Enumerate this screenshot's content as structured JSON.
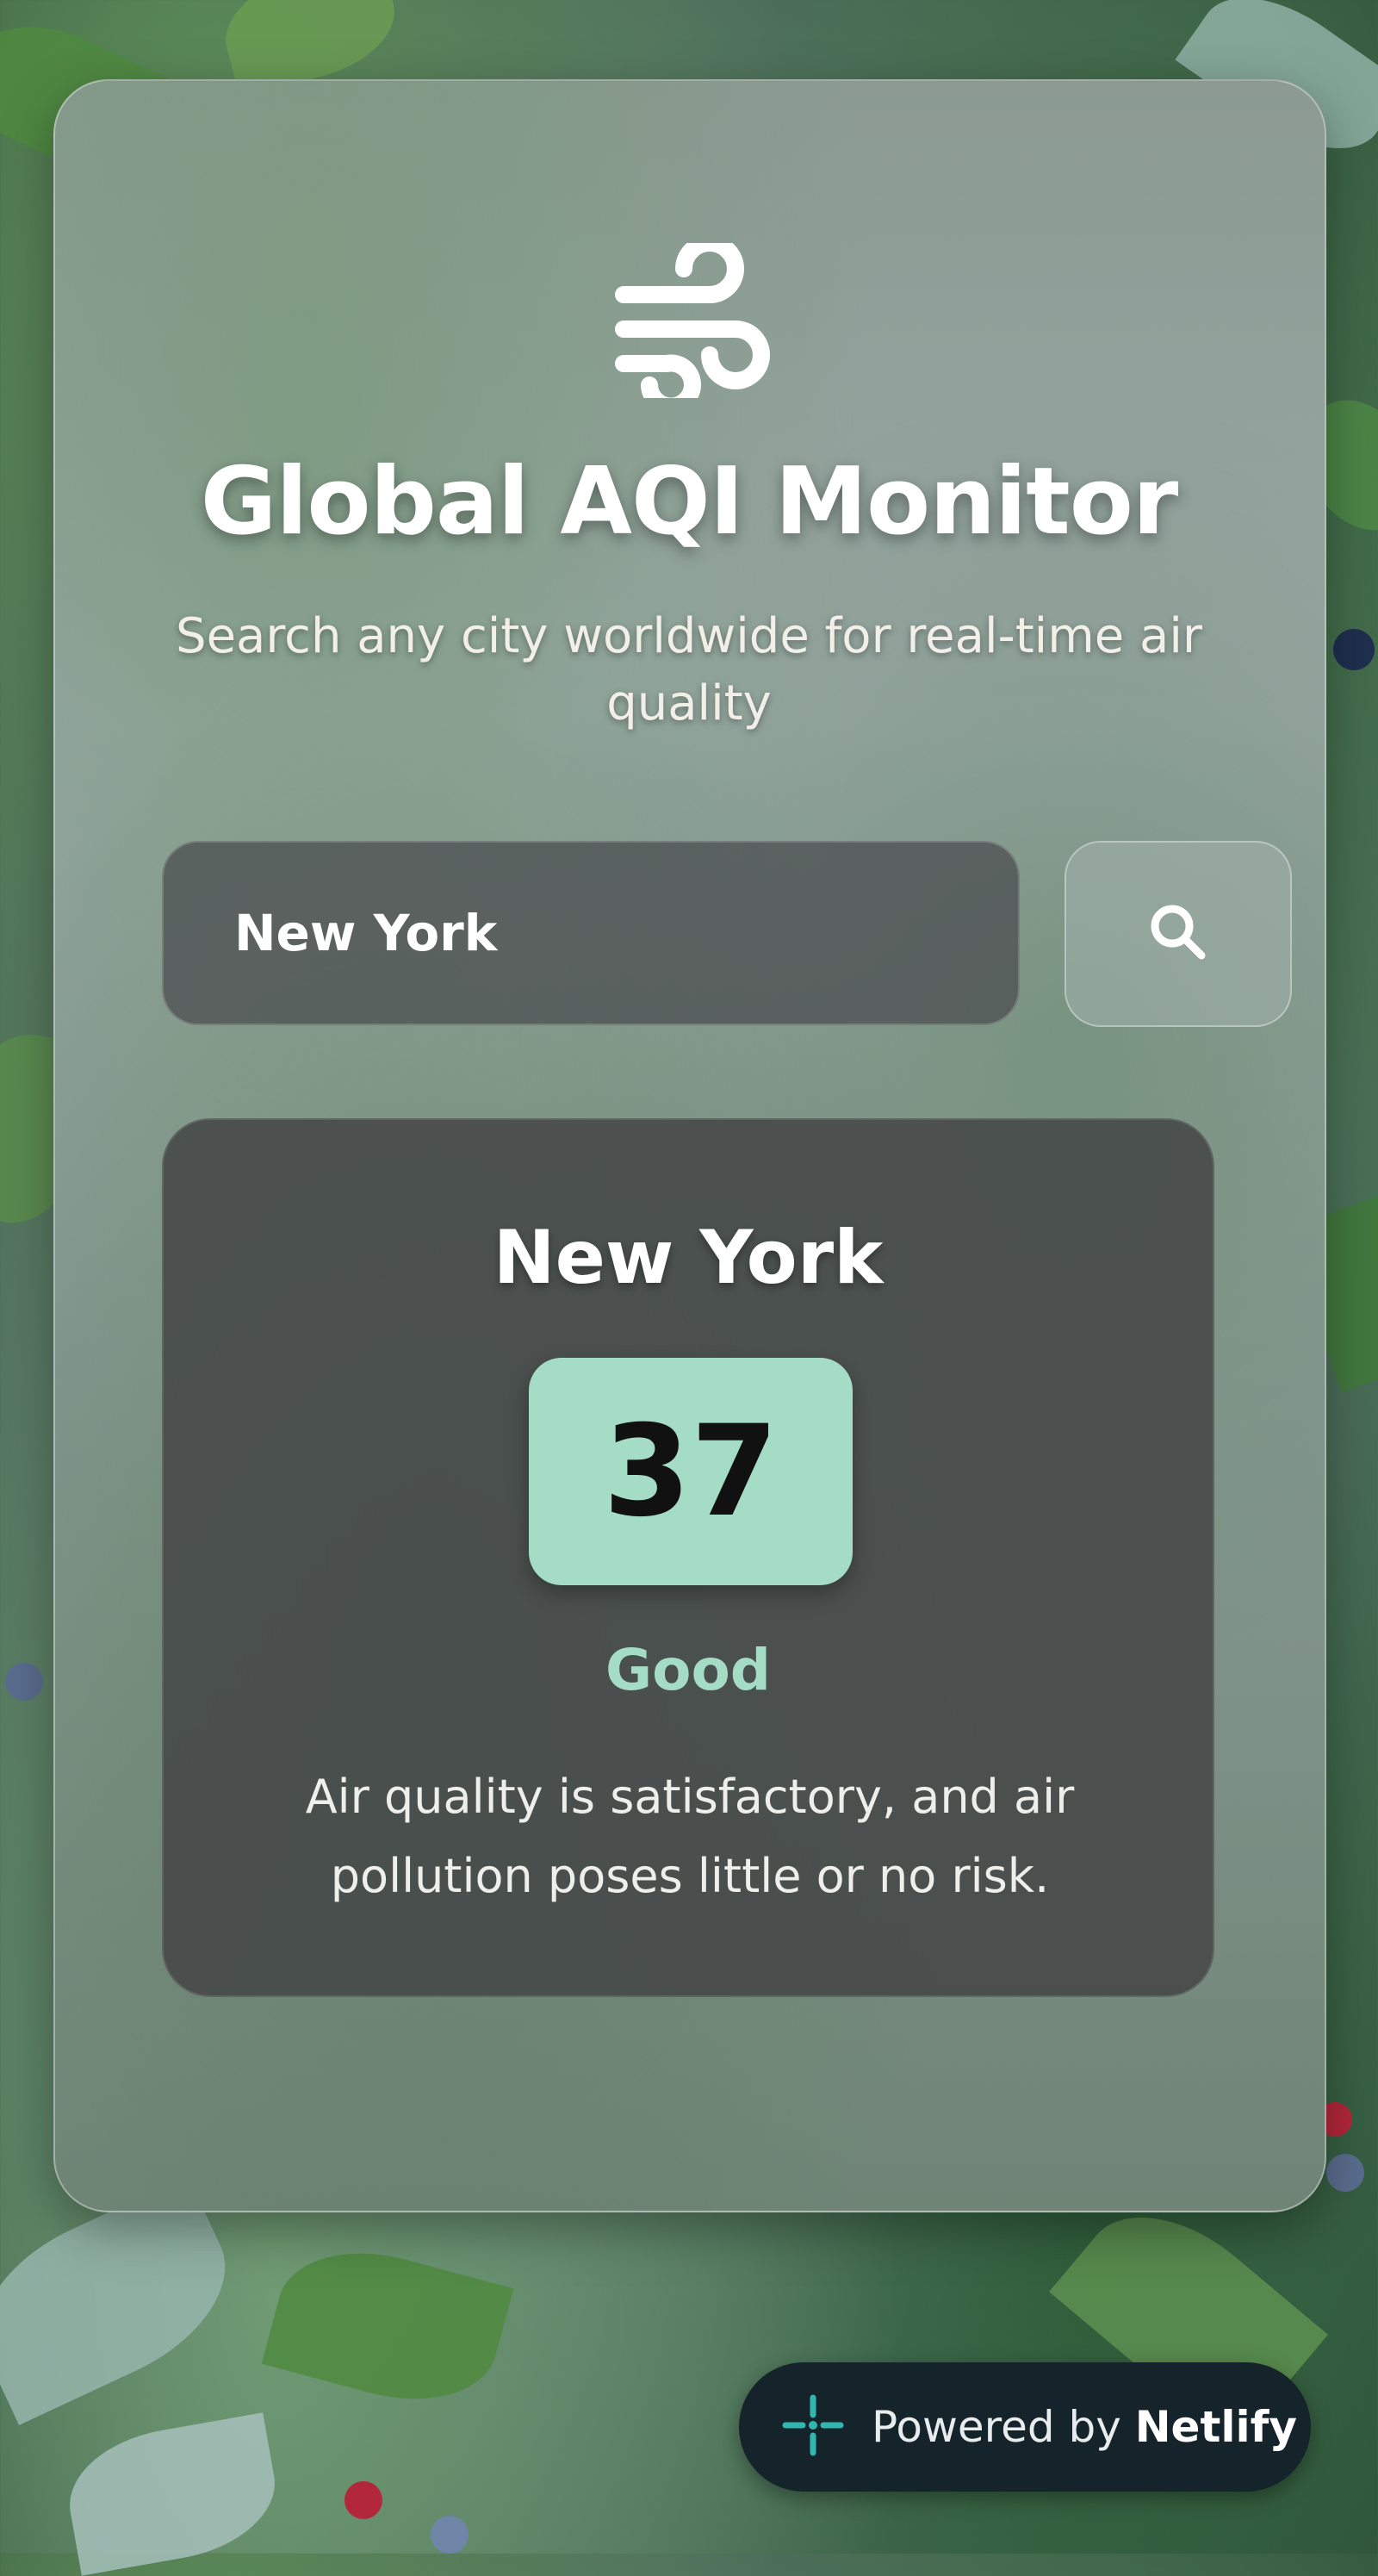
{
  "app": {
    "title": "Global AQI Monitor",
    "subtitle": "Search any city worldwide for real-time air quality",
    "logo_icon": "wind-icon"
  },
  "search": {
    "value": "New York",
    "placeholder": "",
    "button_icon": "search-icon"
  },
  "result": {
    "city": "New York",
    "aqi": "37",
    "level": "Good",
    "description": "Air quality is satisfactory, and air pollution poses little or no risk.",
    "level_color": "#a5dcc6",
    "box_color": "#a5dcc6"
  },
  "footer": {
    "powered_prefix": "Powered by",
    "brand": "Netlify",
    "brand_icon": "netlify-icon",
    "brand_color": "#32b7b0"
  }
}
